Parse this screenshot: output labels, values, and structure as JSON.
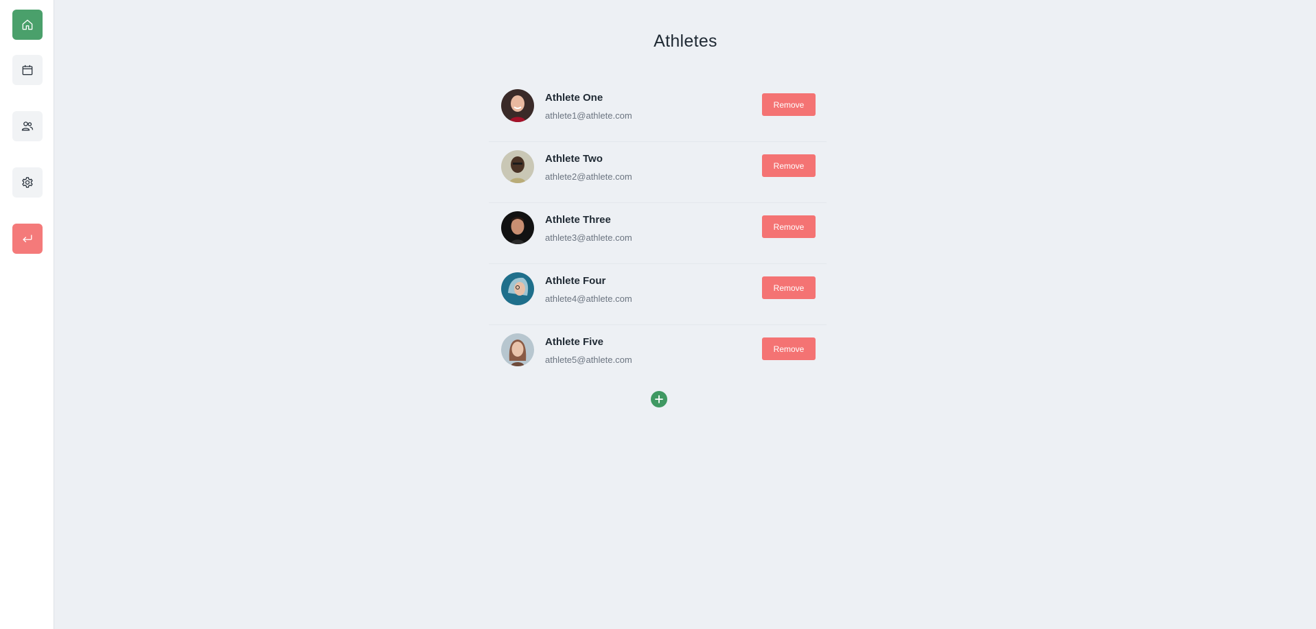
{
  "sidebar": {
    "items": [
      {
        "name": "home",
        "icon": "home-icon",
        "active": true
      },
      {
        "name": "calendar",
        "icon": "calendar-icon",
        "active": false
      },
      {
        "name": "athletes",
        "icon": "users-icon",
        "active": false
      },
      {
        "name": "settings",
        "icon": "gear-icon",
        "active": false
      },
      {
        "name": "logout",
        "icon": "logout-icon",
        "active": false
      }
    ]
  },
  "main": {
    "title": "Athletes",
    "athletes": [
      {
        "name": "Athlete One",
        "email": "athlete1@athlete.com",
        "remove_label": "Remove"
      },
      {
        "name": "Athlete Two",
        "email": "athlete2@athlete.com",
        "remove_label": "Remove"
      },
      {
        "name": "Athlete Three",
        "email": "athlete3@athlete.com",
        "remove_label": "Remove"
      },
      {
        "name": "Athlete Four",
        "email": "athlete4@athlete.com",
        "remove_label": "Remove"
      },
      {
        "name": "Athlete Five",
        "email": "athlete5@athlete.com",
        "remove_label": "Remove"
      }
    ],
    "add_icon": "plus-icon"
  },
  "colors": {
    "accent_green": "#4aa06b",
    "danger_red": "#f47373",
    "background": "#edf0f4"
  }
}
